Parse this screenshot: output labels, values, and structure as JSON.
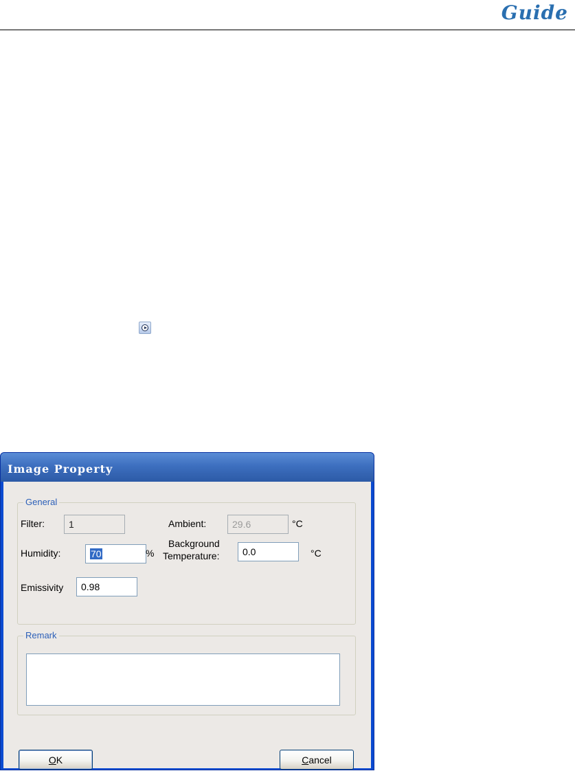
{
  "page": {
    "brand": "Guide"
  },
  "dialog": {
    "title": "Image Property",
    "general": {
      "legend": "General",
      "filter_label": "Filter:",
      "filter_value": "1",
      "ambient_label": "Ambient:",
      "ambient_value": "29.6",
      "ambient_unit": "°C",
      "humidity_label": "Humidity:",
      "humidity_value": "70",
      "humidity_unit": "%",
      "bg_temp_label_line1": "Background",
      "bg_temp_label_line2": "Temperature:",
      "bg_temp_value": "0.0",
      "bg_temp_unit": "°C",
      "emissivity_label": "Emissivity",
      "emissivity_value": "0.98"
    },
    "remark": {
      "legend": "Remark",
      "value": ""
    },
    "buttons": {
      "ok": "OK",
      "cancel": "Cancel"
    }
  },
  "colors": {
    "titlebar": "#3d6fbf",
    "legend_text": "#2b5fb8",
    "selection": "#316ac5",
    "brand": "#2a6fb0"
  },
  "icons": {
    "nav": "circle-right-arrow-icon"
  }
}
